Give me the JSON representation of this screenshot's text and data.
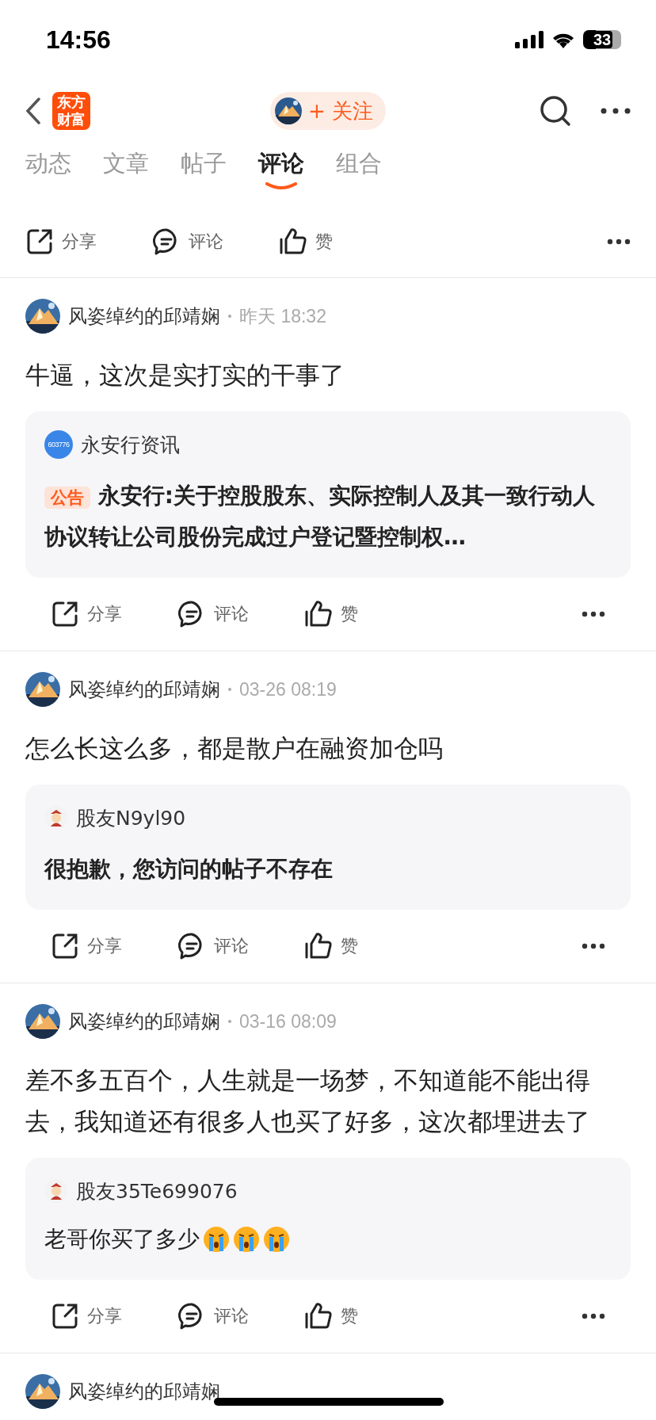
{
  "status_bar": {
    "time": "14:56",
    "battery": "33"
  },
  "header": {
    "logo": "东方财富",
    "follow": "+ 关注"
  },
  "tabs": [
    {
      "label": "动态",
      "selected": false
    },
    {
      "label": "文章",
      "selected": false
    },
    {
      "label": "帖子",
      "selected": false
    },
    {
      "label": "评论",
      "selected": true
    },
    {
      "label": "组合",
      "selected": false
    }
  ],
  "actions": [
    {
      "kind": "share",
      "label": "分享"
    },
    {
      "kind": "comment",
      "label": "评论"
    },
    {
      "kind": "like",
      "label": "赞"
    }
  ],
  "posts": [
    {
      "author": "风姿绰约的邱靖娴",
      "time": "昨天 18:32",
      "text": "牛逼，这次是实打实的干事了",
      "quote": {
        "kind": "news",
        "badge": "603776",
        "source": "永安行资讯",
        "tag": "公告",
        "text": "永安行:关于控股股东、实际控制人及其一致行动人协议转让公司股份完成过户登记暨控制权…"
      },
      "actions": [
        {
          "kind": "share",
          "label": "分享"
        },
        {
          "kind": "comment",
          "label": "评论"
        },
        {
          "kind": "like",
          "label": "赞"
        }
      ]
    },
    {
      "author": "风姿绰约的邱靖娴",
      "time": "03-26 08:19",
      "text": "怎么长这么多，都是散户在融资加仓吗",
      "quote": {
        "kind": "missing",
        "source": "股友N9yl90",
        "text": "很抱歉，您访问的帖子不存在"
      },
      "actions": [
        {
          "kind": "share",
          "label": "分享"
        },
        {
          "kind": "comment",
          "label": "评论"
        },
        {
          "kind": "like",
          "label": "赞"
        }
      ]
    },
    {
      "author": "风姿绰约的邱靖娴",
      "time": "03-16 08:09",
      "text": "差不多五百个，人生就是一场梦，不知道能不能出得去，我知道还有很多人也买了好多，这次都埋进去了",
      "quote": {
        "kind": "reply",
        "source": "股友35Te699076",
        "text": "老哥你买了多少",
        "emojis": [
          {
            "kind": "crying"
          },
          {
            "kind": "crying"
          },
          {
            "kind": "crying"
          }
        ]
      },
      "actions": [
        {
          "kind": "share",
          "label": "分享"
        },
        {
          "kind": "comment",
          "label": "评论"
        },
        {
          "kind": "like",
          "label": "赞"
        }
      ]
    },
    {
      "author": "风姿绰约的邱靖娴"
    }
  ]
}
